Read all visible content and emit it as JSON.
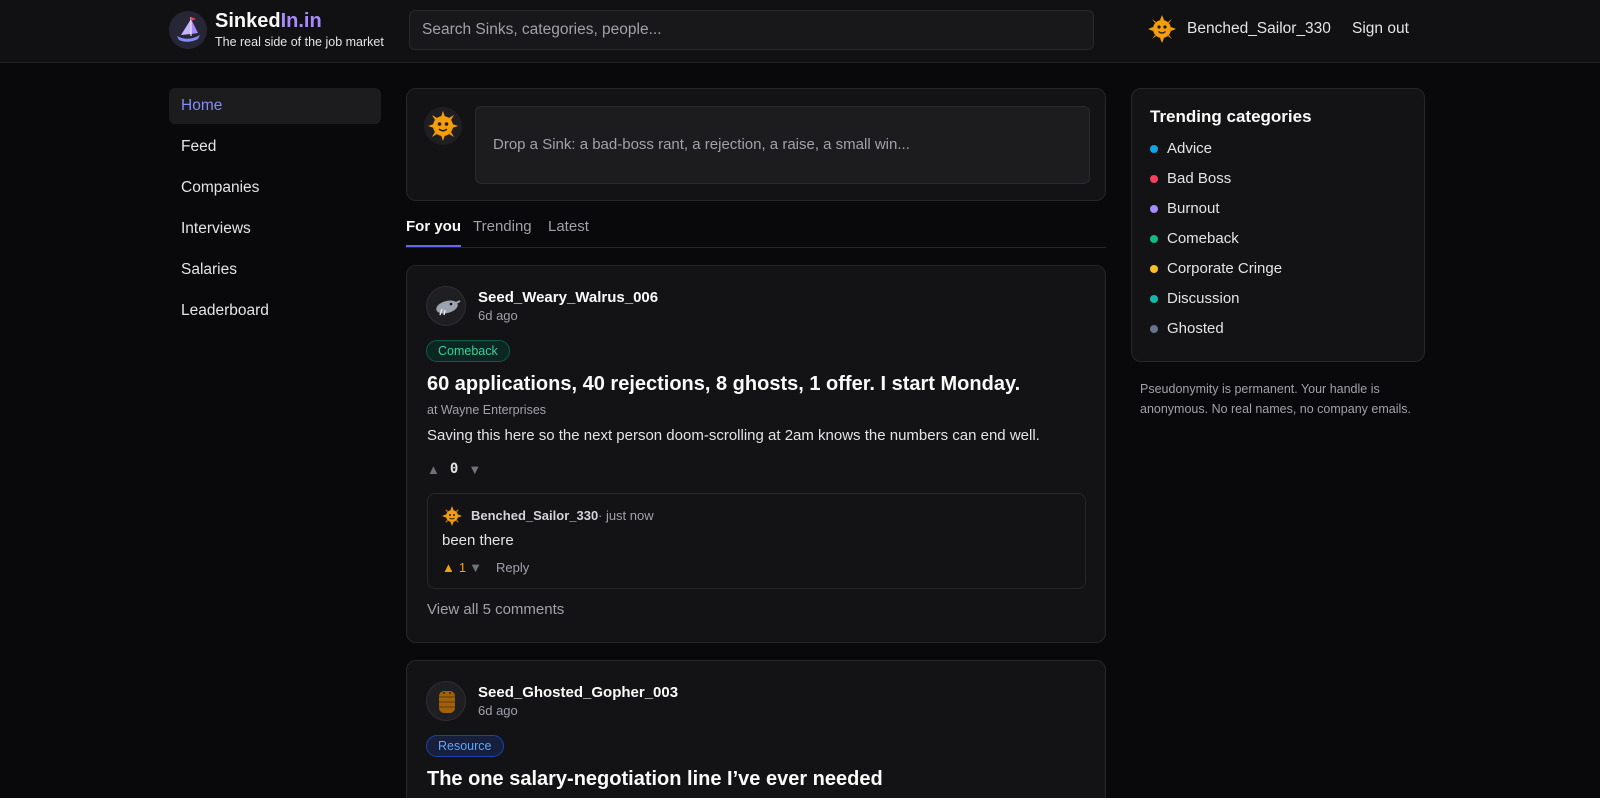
{
  "header": {
    "brand_name": "Sinked",
    "brand_accent": "In.in",
    "tagline": "The real side of the job market",
    "search_placeholder": "Search Sinks, categories, people...",
    "user_name": "Benched_Sailor_330",
    "signout_label": "Sign out"
  },
  "nav": {
    "items": [
      {
        "label": "Home",
        "active": true
      },
      {
        "label": "Feed"
      },
      {
        "label": "Companies"
      },
      {
        "label": "Interviews"
      },
      {
        "label": "Salaries"
      },
      {
        "label": "Leaderboard"
      }
    ]
  },
  "composer": {
    "placeholder": "Drop a Sink: a bad-boss rant, a rejection, a raise, a small win..."
  },
  "tabs": [
    "For you",
    "Trending",
    "Latest"
  ],
  "posts": [
    {
      "author": "Seed_Weary_Walrus_006",
      "time": "6d ago",
      "tag": "Comeback",
      "title": "60 applications, 40 rejections, 8 ghosts, 1 offer. I start Monday.",
      "company": "at Wayne Enterprises",
      "body": "Saving this here so the next person doom-scrolling at 2am knows the numbers can end well.",
      "votes": "0",
      "comment": {
        "author": "Benched_Sailor_330",
        "time": "· just now",
        "body": "been there",
        "votes": "1",
        "reply_label": "Reply"
      },
      "view_all": "View all 5 comments"
    },
    {
      "author": "Seed_Ghosted_Gopher_003",
      "time": "6d ago",
      "tag": "Resource",
      "title": "The one salary-negotiation line I’ve ever needed"
    }
  ],
  "trending": {
    "title": "Trending categories",
    "categories": [
      {
        "label": "Advice",
        "color": "#0ea5e9"
      },
      {
        "label": "Bad Boss",
        "color": "#f43f5e"
      },
      {
        "label": "Burnout",
        "color": "#a78bfa"
      },
      {
        "label": "Comeback",
        "color": "#10b981"
      },
      {
        "label": "Corporate Cringe",
        "color": "#fbbf24"
      },
      {
        "label": "Discussion",
        "color": "#14b8a6"
      },
      {
        "label": "Ghosted",
        "color": "#64748b"
      }
    ]
  },
  "note": "Pseudonymity is permanent. Your handle is anonymous. No real names, no company emails.",
  "colors": {
    "accent": "#6366f1",
    "comeback_tag": "#34d399",
    "resource_tag": "#60a5fa",
    "vote_active": "#f59e0b"
  },
  "icons": {
    "brand": "sinking-ship-logo",
    "user_avatar": "sun-face-avatar",
    "walrus_avatar": "walrus-avatar",
    "gopher_avatar": "barrel-avatar",
    "upvote": "triangle-up-icon",
    "downvote": "triangle-down-icon"
  }
}
